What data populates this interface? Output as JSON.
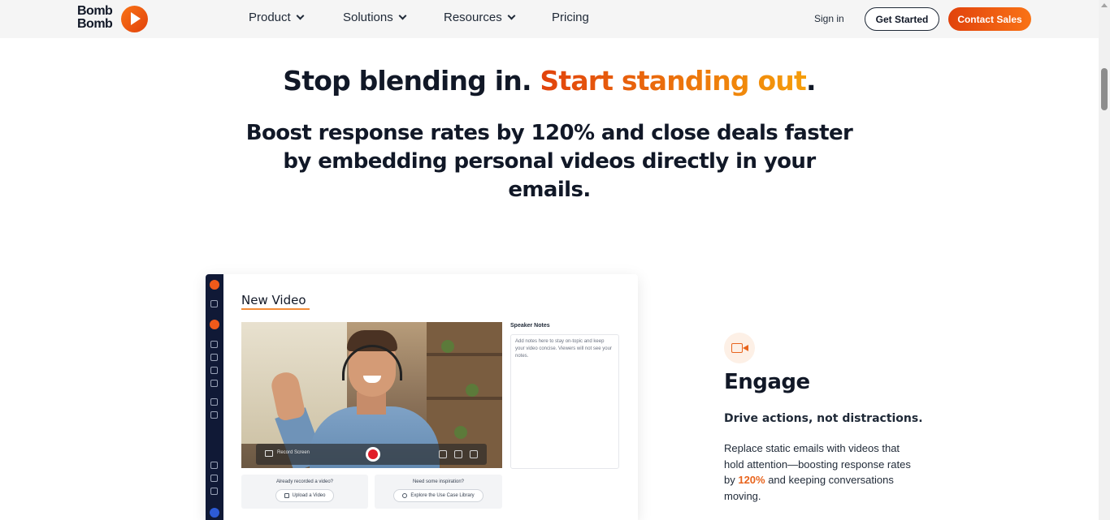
{
  "header": {
    "logo_line1": "Bomb",
    "logo_line2": "Bomb",
    "nav": [
      {
        "label": "Product",
        "has_dropdown": true
      },
      {
        "label": "Solutions",
        "has_dropdown": true
      },
      {
        "label": "Resources",
        "has_dropdown": true
      },
      {
        "label": "Pricing",
        "has_dropdown": false
      }
    ],
    "sign_in": "Sign in",
    "get_started": "Get Started",
    "contact_sales": "Contact Sales"
  },
  "hero": {
    "title_part1": "Stop blending in. ",
    "title_accent": "Start standing out",
    "title_end": ".",
    "subtitle": "Boost response rates by 120% and close deals faster by embedding personal videos directly in your emails."
  },
  "mockup": {
    "title": "New Video",
    "record_screen": "Record Screen",
    "speaker_notes_label": "Speaker Notes",
    "speaker_notes_placeholder": "Add notes here to stay on-topic and keep your video concise. Viewers will not see your notes.",
    "card_upload_title": "Already recorded a video?",
    "card_upload_button": "Upload a Video",
    "card_library_title": "Need some inspiration?",
    "card_library_button": "Explore the Use Case Library"
  },
  "feature": {
    "icon": "video-camera-icon",
    "title": "Engage",
    "subtitle": "Drive actions, not distractions.",
    "body_before": "Replace static emails with videos that hold attention—boosting response rates by ",
    "body_highlight": "120%",
    "body_after": " and keeping conversations moving."
  },
  "colors": {
    "accent": "#e8641d",
    "accent_dark": "#e1420c",
    "text": "#111827",
    "sidebar": "#101936",
    "header_bg": "#f5f5f5"
  }
}
